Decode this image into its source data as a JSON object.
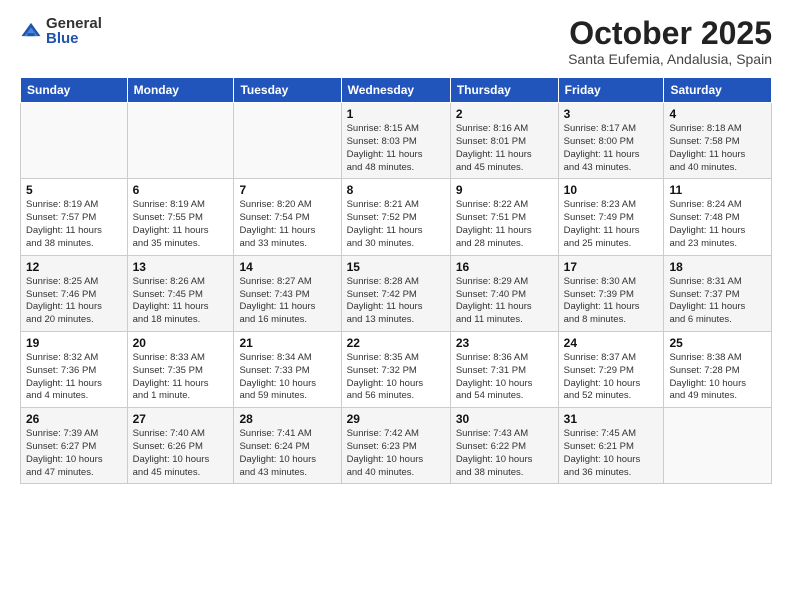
{
  "logo": {
    "general": "General",
    "blue": "Blue"
  },
  "header": {
    "title": "October 2025",
    "location": "Santa Eufemia, Andalusia, Spain"
  },
  "weekdays": [
    "Sunday",
    "Monday",
    "Tuesday",
    "Wednesday",
    "Thursday",
    "Friday",
    "Saturday"
  ],
  "weeks": [
    [
      {
        "day": "",
        "info": ""
      },
      {
        "day": "",
        "info": ""
      },
      {
        "day": "",
        "info": ""
      },
      {
        "day": "1",
        "info": "Sunrise: 8:15 AM\nSunset: 8:03 PM\nDaylight: 11 hours\nand 48 minutes."
      },
      {
        "day": "2",
        "info": "Sunrise: 8:16 AM\nSunset: 8:01 PM\nDaylight: 11 hours\nand 45 minutes."
      },
      {
        "day": "3",
        "info": "Sunrise: 8:17 AM\nSunset: 8:00 PM\nDaylight: 11 hours\nand 43 minutes."
      },
      {
        "day": "4",
        "info": "Sunrise: 8:18 AM\nSunset: 7:58 PM\nDaylight: 11 hours\nand 40 minutes."
      }
    ],
    [
      {
        "day": "5",
        "info": "Sunrise: 8:19 AM\nSunset: 7:57 PM\nDaylight: 11 hours\nand 38 minutes."
      },
      {
        "day": "6",
        "info": "Sunrise: 8:19 AM\nSunset: 7:55 PM\nDaylight: 11 hours\nand 35 minutes."
      },
      {
        "day": "7",
        "info": "Sunrise: 8:20 AM\nSunset: 7:54 PM\nDaylight: 11 hours\nand 33 minutes."
      },
      {
        "day": "8",
        "info": "Sunrise: 8:21 AM\nSunset: 7:52 PM\nDaylight: 11 hours\nand 30 minutes."
      },
      {
        "day": "9",
        "info": "Sunrise: 8:22 AM\nSunset: 7:51 PM\nDaylight: 11 hours\nand 28 minutes."
      },
      {
        "day": "10",
        "info": "Sunrise: 8:23 AM\nSunset: 7:49 PM\nDaylight: 11 hours\nand 25 minutes."
      },
      {
        "day": "11",
        "info": "Sunrise: 8:24 AM\nSunset: 7:48 PM\nDaylight: 11 hours\nand 23 minutes."
      }
    ],
    [
      {
        "day": "12",
        "info": "Sunrise: 8:25 AM\nSunset: 7:46 PM\nDaylight: 11 hours\nand 20 minutes."
      },
      {
        "day": "13",
        "info": "Sunrise: 8:26 AM\nSunset: 7:45 PM\nDaylight: 11 hours\nand 18 minutes."
      },
      {
        "day": "14",
        "info": "Sunrise: 8:27 AM\nSunset: 7:43 PM\nDaylight: 11 hours\nand 16 minutes."
      },
      {
        "day": "15",
        "info": "Sunrise: 8:28 AM\nSunset: 7:42 PM\nDaylight: 11 hours\nand 13 minutes."
      },
      {
        "day": "16",
        "info": "Sunrise: 8:29 AM\nSunset: 7:40 PM\nDaylight: 11 hours\nand 11 minutes."
      },
      {
        "day": "17",
        "info": "Sunrise: 8:30 AM\nSunset: 7:39 PM\nDaylight: 11 hours\nand 8 minutes."
      },
      {
        "day": "18",
        "info": "Sunrise: 8:31 AM\nSunset: 7:37 PM\nDaylight: 11 hours\nand 6 minutes."
      }
    ],
    [
      {
        "day": "19",
        "info": "Sunrise: 8:32 AM\nSunset: 7:36 PM\nDaylight: 11 hours\nand 4 minutes."
      },
      {
        "day": "20",
        "info": "Sunrise: 8:33 AM\nSunset: 7:35 PM\nDaylight: 11 hours\nand 1 minute."
      },
      {
        "day": "21",
        "info": "Sunrise: 8:34 AM\nSunset: 7:33 PM\nDaylight: 10 hours\nand 59 minutes."
      },
      {
        "day": "22",
        "info": "Sunrise: 8:35 AM\nSunset: 7:32 PM\nDaylight: 10 hours\nand 56 minutes."
      },
      {
        "day": "23",
        "info": "Sunrise: 8:36 AM\nSunset: 7:31 PM\nDaylight: 10 hours\nand 54 minutes."
      },
      {
        "day": "24",
        "info": "Sunrise: 8:37 AM\nSunset: 7:29 PM\nDaylight: 10 hours\nand 52 minutes."
      },
      {
        "day": "25",
        "info": "Sunrise: 8:38 AM\nSunset: 7:28 PM\nDaylight: 10 hours\nand 49 minutes."
      }
    ],
    [
      {
        "day": "26",
        "info": "Sunrise: 7:39 AM\nSunset: 6:27 PM\nDaylight: 10 hours\nand 47 minutes."
      },
      {
        "day": "27",
        "info": "Sunrise: 7:40 AM\nSunset: 6:26 PM\nDaylight: 10 hours\nand 45 minutes."
      },
      {
        "day": "28",
        "info": "Sunrise: 7:41 AM\nSunset: 6:24 PM\nDaylight: 10 hours\nand 43 minutes."
      },
      {
        "day": "29",
        "info": "Sunrise: 7:42 AM\nSunset: 6:23 PM\nDaylight: 10 hours\nand 40 minutes."
      },
      {
        "day": "30",
        "info": "Sunrise: 7:43 AM\nSunset: 6:22 PM\nDaylight: 10 hours\nand 38 minutes."
      },
      {
        "day": "31",
        "info": "Sunrise: 7:45 AM\nSunset: 6:21 PM\nDaylight: 10 hours\nand 36 minutes."
      },
      {
        "day": "",
        "info": ""
      }
    ]
  ]
}
